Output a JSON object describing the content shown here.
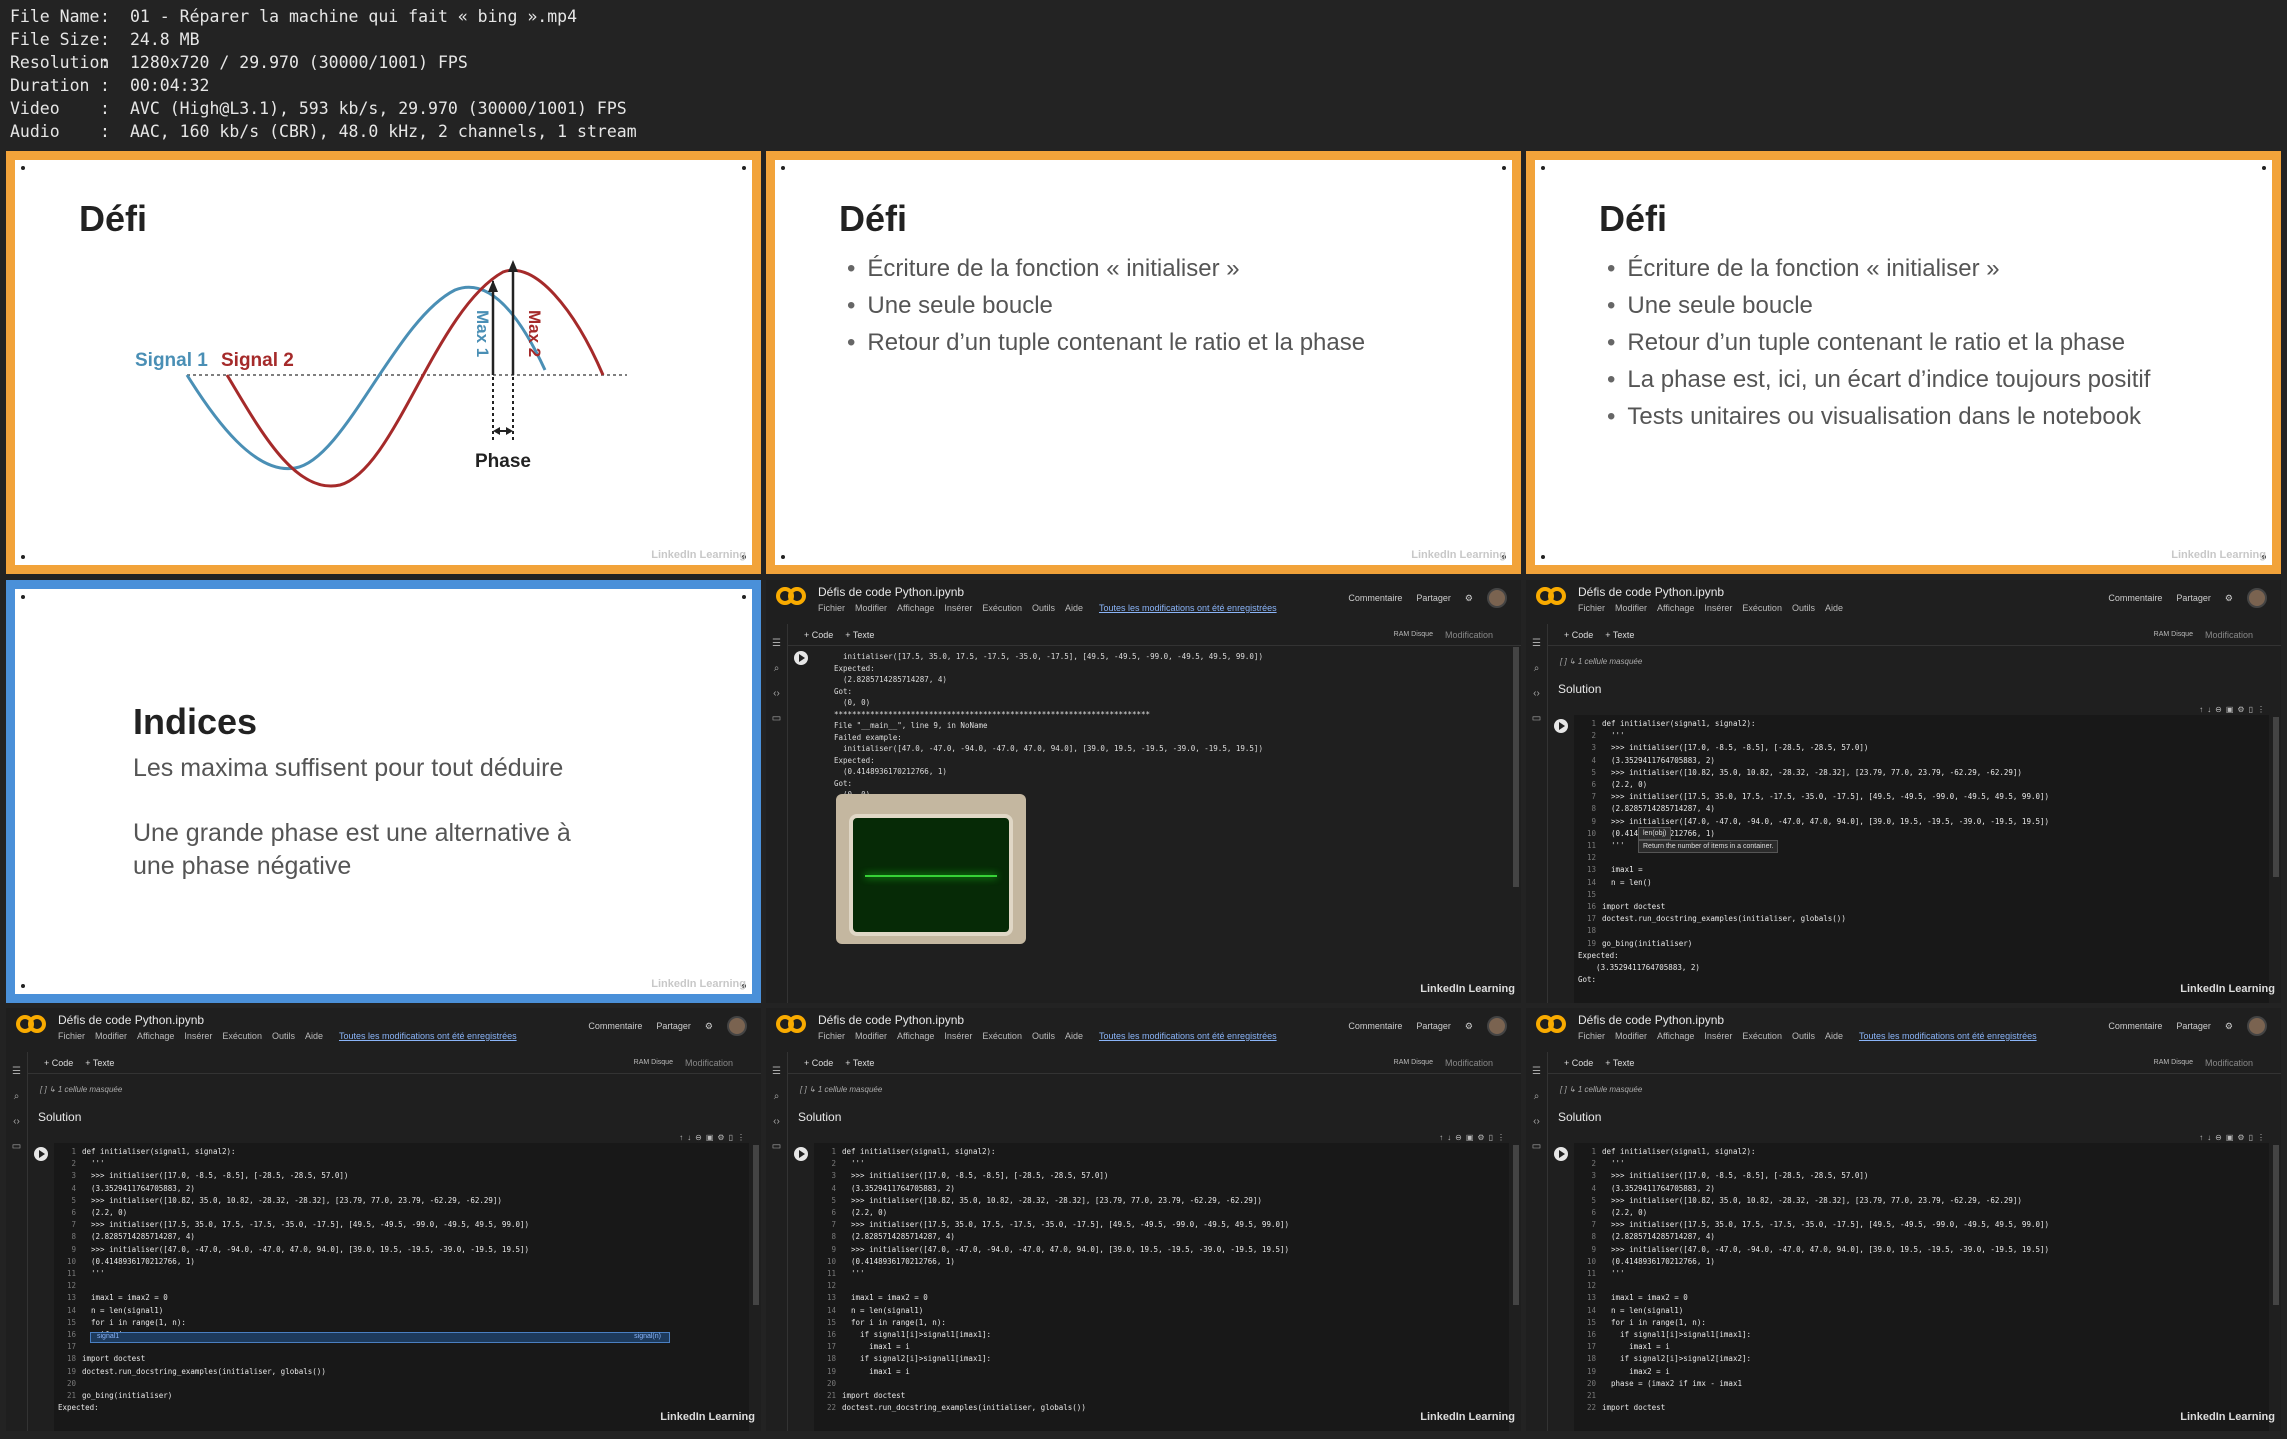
{
  "meta": [
    {
      "key": "File Name",
      "value": "01 - Réparer la machine qui fait « bing ».mp4"
    },
    {
      "key": "File Size",
      "value": "24.8 MB"
    },
    {
      "key": "Resolution",
      "value": "1280x720 / 29.970 (30000/1001) FPS"
    },
    {
      "key": "Duration",
      "value": "00:04:32"
    },
    {
      "key": "Video",
      "value": "AVC (High@L3.1), 593 kb/s, 29.970 (30000/1001) FPS"
    },
    {
      "key": "Audio",
      "value": "AAC, 160 kb/s (CBR), 48.0 kHz, 2 channels, 1 stream"
    }
  ],
  "watermark": "LinkedIn Learning",
  "slide1": {
    "title": "Défi",
    "signal1": "Signal 1",
    "signal2": "Signal 2",
    "max1": "Max 1",
    "max2": "Max 2",
    "phase": "Phase"
  },
  "slide2": {
    "title": "Défi",
    "bullets": [
      "Écriture de la fonction « initialiser »",
      "Une seule boucle",
      "Retour d’un tuple contenant le ratio et la phase"
    ]
  },
  "slide3": {
    "title": "Défi",
    "bullets": [
      "Écriture de la fonction « initialiser »",
      "Une seule boucle",
      "Retour d’un tuple contenant le ratio et la phase",
      "La phase est, ici, un écart d’indice toujours positif",
      "Tests unitaires ou visualisation dans le notebook"
    ]
  },
  "slide4": {
    "title": "Indices",
    "p1": "Les maxima suffisent pour tout déduire",
    "p2": "Une grande phase est une alternative à une phase négative"
  },
  "colab": {
    "title": "Défis de code Python.ipynb",
    "menu": [
      "Fichier",
      "Modifier",
      "Affichage",
      "Insérer",
      "Exécution",
      "Outils",
      "Aide"
    ],
    "saved": "Toutes les modifications ont été enregistrées",
    "comment": "Commentaire",
    "share": "Partager",
    "code_btn": "+ Code",
    "text_btn": "+ Texte",
    "ram": "RAM Disque",
    "modification": "Modification",
    "hidden": "[ ] ↳ 1 cellule masquée",
    "solution": "Solution",
    "tooltip_sig": "len(obj)",
    "tooltip_doc": "Return the number of items in a container.",
    "ac_item": "signal1",
    "ac_hint": "signal(n)"
  },
  "output": {
    "lines": [
      "  initialiser([17.5, 35.0, 17.5, -17.5, -35.0, -17.5], [49.5, -49.5, -99.0, -49.5, 49.5, 99.0])",
      "Expected:",
      "  (2.8285714285714287, 4)",
      "Got:",
      "  (0, 0)",
      "**********************************************************************",
      "File \"__main__\", line 9, in NoName",
      "Failed example:",
      "  initialiser([47.0, -47.0, -94.0, -47.0, 47.0, 94.0], [39.0, 19.5, -19.5, -39.0, -19.5, 19.5])",
      "Expected:",
      "  (0.4148936170212766, 1)",
      "Got:",
      "  (0, 0)"
    ]
  },
  "code_common": [
    "def initialiser(signal1, signal2):",
    "  '''",
    "  >>> initialiser([17.0, -8.5, -8.5], [-28.5, -28.5, 57.0])",
    "  (3.3529411764705883, 2)",
    "  >>> initialiser([10.82, 35.0, 10.82, -28.32, -28.32], [23.79, 77.0, 23.79, -62.29, -62.29])",
    "  (2.2, 0)",
    "  >>> initialiser([17.5, 35.0, 17.5, -17.5, -35.0, -17.5], [49.5, -49.5, -99.0, -49.5, 49.5, 99.0])",
    "  (2.8285714285714287, 4)",
    "  >>> initialiser([47.0, -47.0, -94.0, -47.0, 47.0, 94.0], [39.0, 19.5, -19.5, -39.0, -19.5, 19.5])",
    "  (0.4148936170212766, 1)",
    "  '''"
  ],
  "code_tiles": [
    {
      "tail": [
        "",
        "  imax1 = ",
        "  n = len()",
        "",
        "import doctest",
        "doctest.run_docstring_examples(initialiser, globals())",
        "",
        "go_bing(initialiser)"
      ],
      "after": [
        "Expected:",
        "    (3.3529411764705883, 2)",
        "Got:"
      ]
    },
    {
      "tail": [
        "",
        "  imax1 = imax2 = 0",
        "  n = len(signal1)",
        "  for i in range(1, n):",
        "    if signa",
        "",
        "import doctest",
        "doctest.run_docstring_examples(initialiser, globals())",
        "",
        "go_bing(initialiser)"
      ],
      "after": [
        "Expected:"
      ]
    },
    {
      "tail": [
        "",
        "  imax1 = imax2 = 0",
        "  n = len(signal1)",
        "  for i in range(1, n):",
        "    if signal1[i]>signal1[imax1]:",
        "      imax1 = i",
        "    if signal2[i]>signal1[imax1]:",
        "      imax1 = i",
        "",
        "import doctest",
        "doctest.run_docstring_examples(initialiser, globals())"
      ],
      "after": []
    },
    {
      "tail": [
        "",
        "  imax1 = imax2 = 0",
        "  n = len(signal1)",
        "  for i in range(1, n):",
        "    if signal1[i]>signal1[imax1]:",
        "      imax1 = i",
        "    if signal2[i]>signal2[imax2]:",
        "      imax2 = i",
        "  phase = (imax2 if imx - imax1",
        "",
        "import doctest"
      ],
      "after": []
    }
  ]
}
